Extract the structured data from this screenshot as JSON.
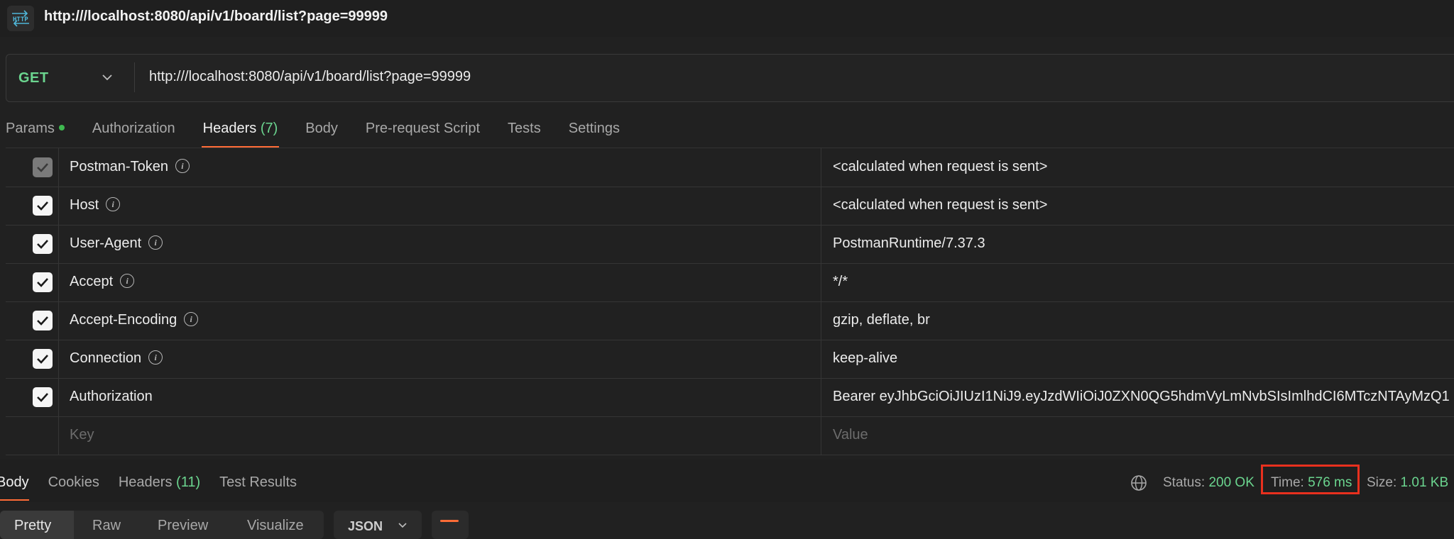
{
  "window": {
    "title": "http:///localhost:8080/api/v1/board/list?page=99999",
    "icon": "http-icon"
  },
  "request": {
    "method": "GET",
    "url": "http:///localhost:8080/api/v1/board/list?page=99999"
  },
  "request_tabs": {
    "params": "Params",
    "authorization": "Authorization",
    "headers": "Headers",
    "headers_count": "(7)",
    "body": "Body",
    "prerequest": "Pre-request Script",
    "tests": "Tests",
    "settings": "Settings"
  },
  "headers": [
    {
      "key": "Postman-Token",
      "value": "<calculated when request is sent>",
      "checked": true,
      "disabled": true
    },
    {
      "key": "Host",
      "value": "<calculated when request is sent>",
      "checked": true,
      "disabled": false
    },
    {
      "key": "User-Agent",
      "value": "PostmanRuntime/7.37.3",
      "checked": true,
      "disabled": false
    },
    {
      "key": "Accept",
      "value": "*/*",
      "checked": true,
      "disabled": false
    },
    {
      "key": "Accept-Encoding",
      "value": "gzip, deflate, br",
      "checked": true,
      "disabled": false
    },
    {
      "key": "Connection",
      "value": "keep-alive",
      "checked": true,
      "disabled": false
    },
    {
      "key": "Authorization",
      "value": "Bearer eyJhbGciOiJIUzI1NiJ9.eyJzdWIiOiJ0ZXN0QG5hdmVyLmNvbSIsImlhdCI6MTczNTAyMzQ1",
      "checked": true,
      "disabled": false
    }
  ],
  "new_header": {
    "key_placeholder": "Key",
    "value_placeholder": "Value"
  },
  "response_tabs": {
    "body": "Body",
    "cookies": "Cookies",
    "headers": "Headers",
    "headers_count": "(11)",
    "test_results": "Test Results"
  },
  "response_meta": {
    "status_label": "Status:",
    "status_value": "200 OK",
    "time_label": "Time:",
    "time_value": "576 ms",
    "size_label": "Size:",
    "size_value": "1.01 KB"
  },
  "response_view": {
    "pretty": "Pretty",
    "raw": "Raw",
    "preview": "Preview",
    "visualize": "Visualize",
    "format": "JSON"
  },
  "colors": {
    "accent": "#ff6c37",
    "success": "#6bd58f",
    "highlight_box": "#e8301e",
    "background": "#212121"
  }
}
